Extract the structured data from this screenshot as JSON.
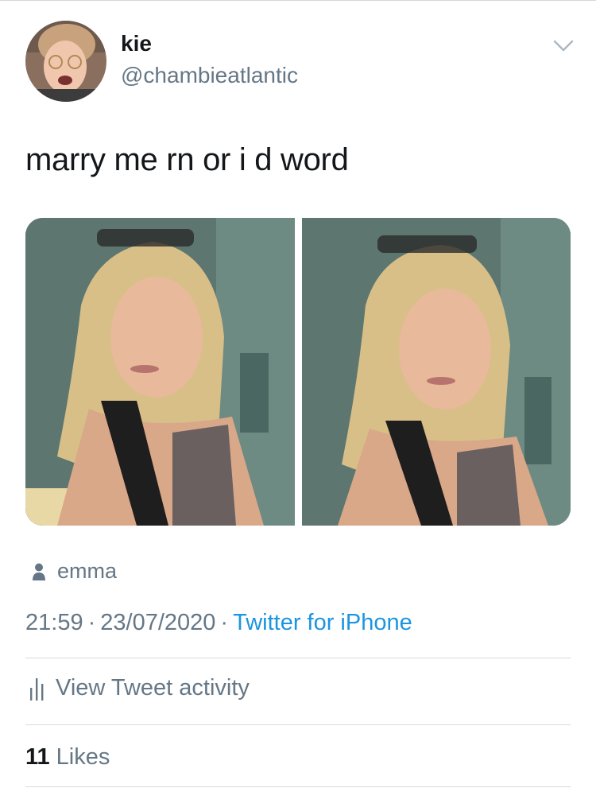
{
  "tweet": {
    "display_name": "kie",
    "handle": "@chambieatlantic",
    "text": "marry me rn or i d word",
    "tagged_user": "emma",
    "time": "21:59",
    "date": "23/07/2020",
    "separator": "·",
    "source": "Twitter for iPhone",
    "activity_label": "View Tweet activity",
    "likes_count": "11",
    "likes_label": "Likes"
  },
  "colors": {
    "primary_text": "#14171a",
    "secondary_text": "#657786",
    "link": "#1b95e0",
    "divider": "#d6d9dc"
  },
  "icons": {
    "menu": "chevron-down-icon",
    "tag": "person-icon",
    "activity": "bar-chart-icon"
  }
}
